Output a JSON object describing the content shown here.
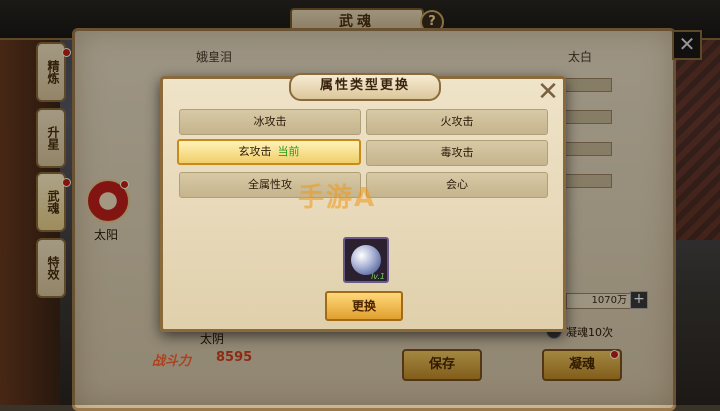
{
  "header": {
    "title": "武魂",
    "help_icon": "?"
  },
  "side_tabs": [
    "精炼",
    "升星",
    "武魂",
    "特效"
  ],
  "background": {
    "name_left": "娥皇泪",
    "name_right": "太白",
    "taiyang": "太阳",
    "taiyin": "太阴",
    "combat_label": "战斗力",
    "combat_value": "8595",
    "amount": "1070万",
    "ning_hun_label": "凝魂10次",
    "save_button": "保存",
    "ning_hun_button": "凝魂"
  },
  "dialog": {
    "title": "属性类型更换",
    "options": [
      {
        "label": "冰攻击",
        "selected": false
      },
      {
        "label": "火攻击",
        "selected": false
      },
      {
        "label": "玄攻击",
        "selected": true,
        "tag": "当前"
      },
      {
        "label": "毒攻击",
        "selected": false
      },
      {
        "label": "全属性攻",
        "selected": false
      },
      {
        "label": "会心",
        "selected": false
      }
    ],
    "gem_level": "lv.1",
    "change_button": "更换"
  },
  "watermark": "手游A"
}
